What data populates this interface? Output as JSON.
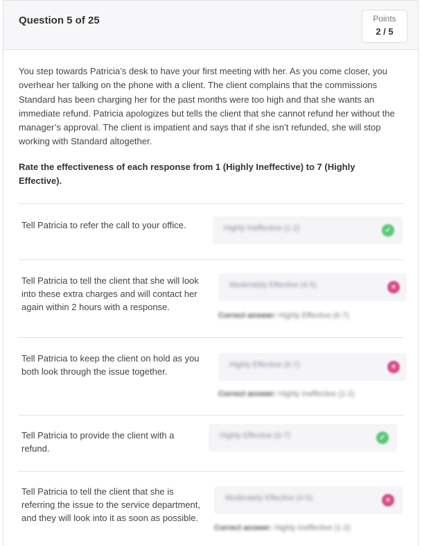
{
  "header": {
    "question_label": "Question 5 of 25",
    "points_label": "Points",
    "points_value": "2 / 5"
  },
  "scenario": "You step towards Patricia’s desk to have your first meeting with her. As you come closer, you overhear her talking on the phone with a client. The client complains that the commissions Standard has been charging her for the past months were too high and that she wants an immediate refund. Patricia apologizes but tells the client that she cannot refund her without the manager’s approval. The client is impatient and says that if she isn’t refunded, she will stop working with Standard altogether.",
  "instruction": "Rate the effectiveness of each response from 1 (Highly Ineffective) to 7 (Highly Effective).",
  "responses": [
    {
      "text": "Tell Patricia to refer the call to your office.",
      "selected": "Highly Ineffective (1-2)",
      "status": "correct",
      "status_icon": "check-circle-icon",
      "correct_answer_label": "",
      "correct_answer": ""
    },
    {
      "text": "Tell Patricia to tell the client that she will look into these extra charges and will contact her again within 2 hours with a response.",
      "selected": "Moderately Effective (4-5)",
      "status": "incorrect",
      "status_icon": "x-circle-icon",
      "correct_answer_label": "Correct answer:",
      "correct_answer": "Highly Effective (6-7)"
    },
    {
      "text": "Tell Patricia to keep the client on hold as you both look through the issue together.",
      "selected": "Highly Effective (6-7)",
      "status": "incorrect",
      "status_icon": "x-circle-icon",
      "correct_answer_label": "Correct answer:",
      "correct_answer": "Highly Ineffective (1-2)"
    },
    {
      "text": "Tell Patricia to provide the client with a refund.",
      "selected": "Highly Effective (6-7)",
      "status": "correct",
      "status_icon": "check-circle-icon",
      "correct_answer_label": "",
      "correct_answer": ""
    },
    {
      "text": "Tell Patricia to tell the client that she is referring the issue to the service department, and they will look into it as soon as possible.",
      "selected": "Moderately Effective (4-5)",
      "status": "incorrect",
      "status_icon": "x-circle-icon",
      "correct_answer_label": "Correct answer:",
      "correct_answer": "Highly Ineffective (1-2)"
    }
  ],
  "colors": {
    "correct": "#5cc77a",
    "incorrect": "#d94c8c",
    "header_bg": "#f7f7f9"
  }
}
